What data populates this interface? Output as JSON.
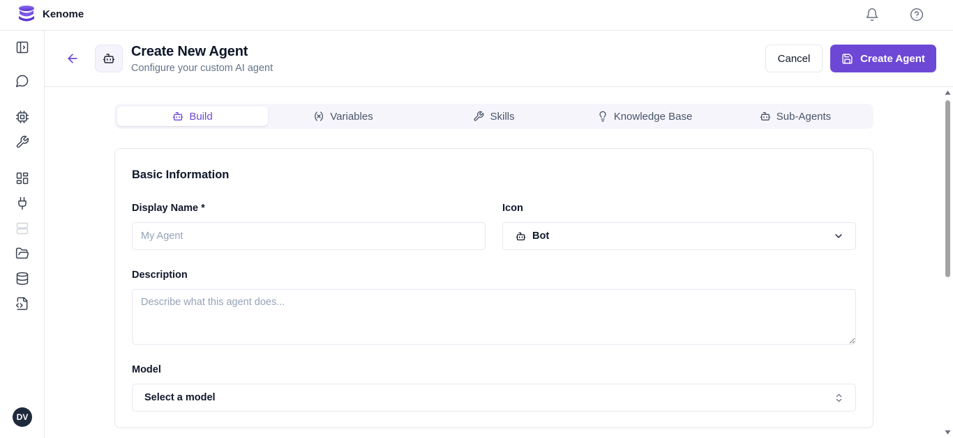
{
  "app": {
    "name": "Kenome"
  },
  "header": {
    "title": "Create New Agent",
    "subtitle": "Configure your custom AI agent",
    "cancel_label": "Cancel",
    "create_label": "Create Agent"
  },
  "user": {
    "initials": "DV"
  },
  "tabs": [
    {
      "label": "Build",
      "icon": "bot-icon",
      "active": true
    },
    {
      "label": "Variables",
      "icon": "variable-icon",
      "active": false
    },
    {
      "label": "Skills",
      "icon": "wrench-icon",
      "active": false
    },
    {
      "label": "Knowledge Base",
      "icon": "lightbulb-icon",
      "active": false
    },
    {
      "label": "Sub-Agents",
      "icon": "bot-icon",
      "active": false
    }
  ],
  "form": {
    "section_title": "Basic Information",
    "display_name": {
      "label": "Display Name *",
      "placeholder": "My Agent",
      "value": ""
    },
    "icon": {
      "label": "Icon",
      "value": "Bot"
    },
    "description": {
      "label": "Description",
      "placeholder": "Describe what this agent does...",
      "value": ""
    },
    "model": {
      "label": "Model",
      "value": "Select a model"
    }
  },
  "colors": {
    "accent": "#6d48d6",
    "border": "#e5e7eb",
    "muted_text": "#64748b"
  }
}
